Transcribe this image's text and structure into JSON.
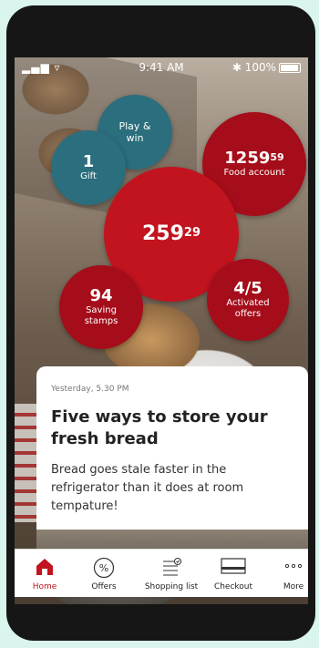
{
  "status": {
    "signal": "▂▄▆ ▿",
    "time": "9:41 AM",
    "battery": "✱ 100%"
  },
  "bubbles": {
    "play_win": "Play & win",
    "gift_count": "1",
    "gift_label": "Gift",
    "food_account_main": "1259",
    "food_account_cents": "59",
    "food_account_label": "Food account",
    "balance_main": "259",
    "balance_cents": "29",
    "stamps_count": "94",
    "stamps_label": "Saving stamps",
    "offers_count": "4/5",
    "offers_label": "Activated offers"
  },
  "article": {
    "timestamp": "Yesterday, 5.30 PM",
    "title": "Five ways to store your fresh bread",
    "body": "Bread goes stale faster in the refrigerator than it does at room tempature!"
  },
  "tabs": [
    {
      "label": "Home",
      "icon": "home-icon"
    },
    {
      "label": "Offers",
      "icon": "percent-icon"
    },
    {
      "label": "Shopping list",
      "icon": "list-icon"
    },
    {
      "label": "Checkout",
      "icon": "card-icon"
    },
    {
      "label": "More",
      "icon": "more-icon"
    }
  ],
  "colors": {
    "accent": "#c1141f",
    "teal": "#2b6e7d",
    "dark_red": "#a50d1a"
  }
}
